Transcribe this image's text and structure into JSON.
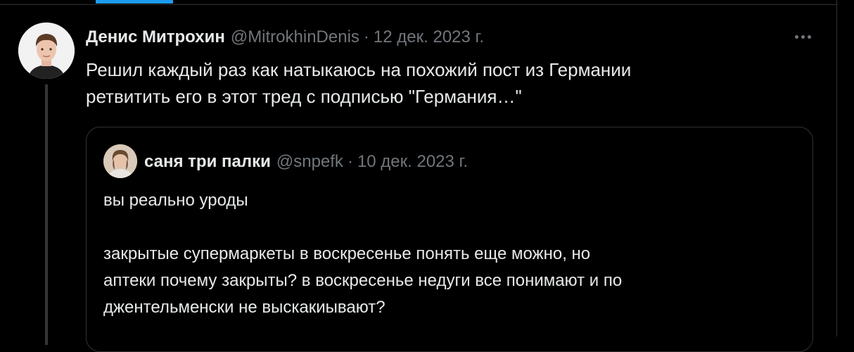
{
  "colors": {
    "background": "#000000",
    "text": "#e7e9ea",
    "muted": "#71767b",
    "border": "#2f3336",
    "accent": "#1d9bf0"
  },
  "tweet": {
    "author_name": "Денис Митрохин",
    "handle": "@MitrokhinDenis",
    "separator": "·",
    "date": "12 дек. 2023 г.",
    "more_icon": "more-horizontal-icon",
    "text_lines": [
      "Решил каждый раз как натыкаюсь на похожий пост из Германии",
      "ретвитить его в этот тред с подписью \"Германия…\""
    ]
  },
  "quote": {
    "author_name": "саня три палки",
    "handle": "@snpefk",
    "separator": "·",
    "date": "10 дек. 2023 г.",
    "paragraph1": "вы реально уроды",
    "paragraph2_lines": [
      "закрытые супермаркеты в воскресенье понять еще можно, но",
      "аптеки почему закрыты? в воскресенье недуги все понимают и по",
      "джентельменски не выскакиывают?"
    ]
  }
}
